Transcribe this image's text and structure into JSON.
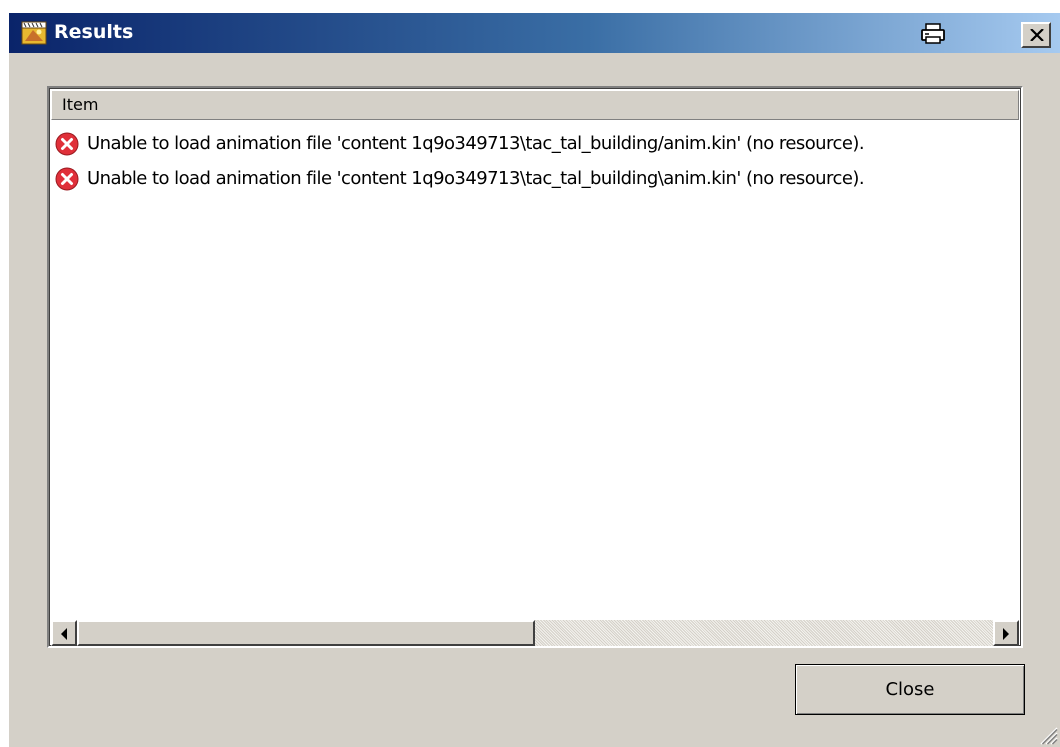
{
  "window": {
    "title": "Results",
    "icons": {
      "app": "app-icon",
      "print": "print-icon",
      "close": "close-icon"
    }
  },
  "list": {
    "column_header": "Item",
    "rows": [
      {
        "icon": "error-icon",
        "message": "Unable to load animation file 'content 1q9o349713\\tac_tal_building/anim.kin' (no resource)."
      },
      {
        "icon": "error-icon",
        "message": "Unable to load animation file 'content 1q9o349713\\tac_tal_building\\anim.kin' (no resource)."
      }
    ],
    "horizontal_scroll_fraction": 0.0
  },
  "buttons": {
    "close_label": "Close"
  },
  "colors": {
    "titlebar_start": "#0a246a",
    "titlebar_end": "#a6caf0",
    "face": "#d4d0c8",
    "error": "#e0303a"
  }
}
